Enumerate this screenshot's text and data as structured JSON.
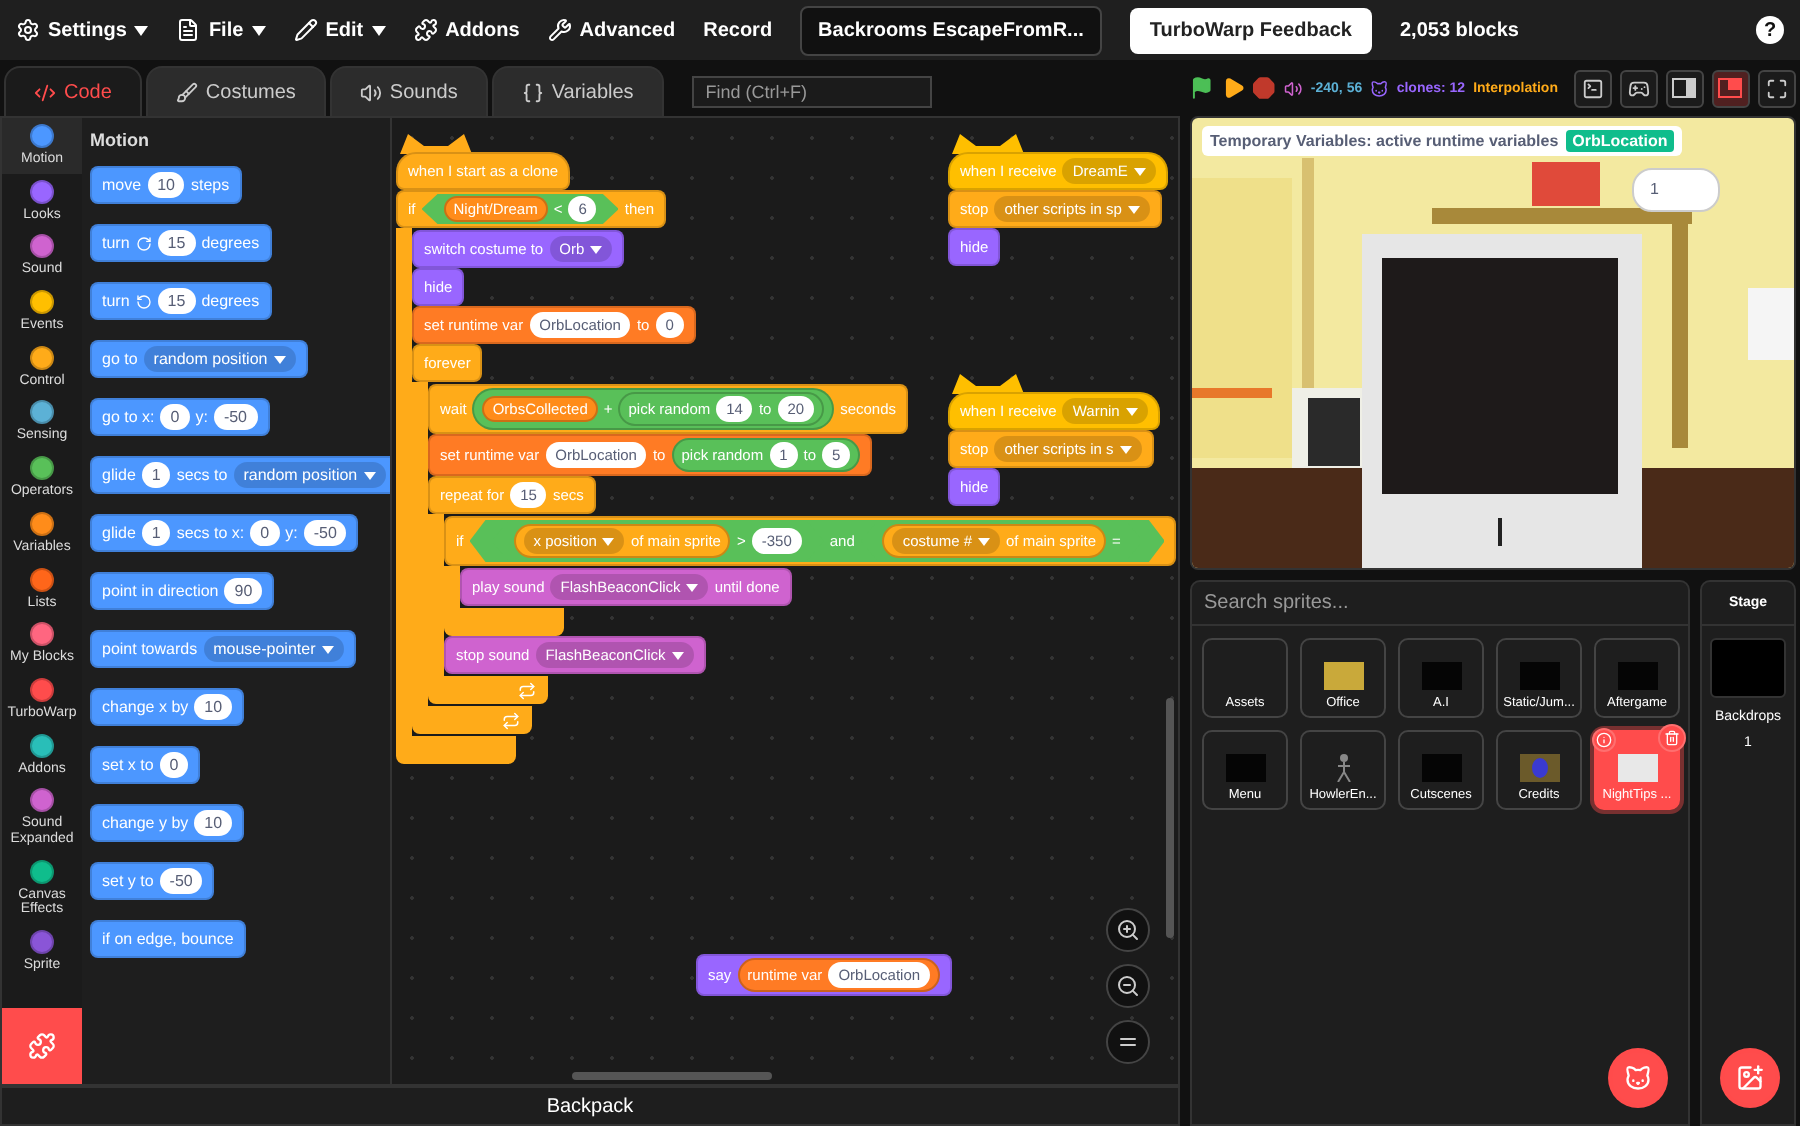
{
  "menubar": {
    "items": [
      {
        "label": "Settings",
        "kind": "settings",
        "menu": true
      },
      {
        "label": "File",
        "kind": "file",
        "menu": true
      },
      {
        "label": "Edit",
        "kind": "edit",
        "menu": true
      },
      {
        "label": "Addons",
        "kind": "addons",
        "menu": false
      },
      {
        "label": "Advanced",
        "kind": "advanced",
        "menu": false
      },
      {
        "label": "Record",
        "kind": "plain",
        "menu": false
      }
    ],
    "project_title": "Backrooms EscapeFromR...",
    "feedback_button": "TurboWarp Feedback",
    "block_count": "2,053 blocks",
    "help": "?"
  },
  "tabs": [
    {
      "label": "Code",
      "kind": "code",
      "selected": true
    },
    {
      "label": "Costumes",
      "kind": "costumes",
      "selected": false
    },
    {
      "label": "Sounds",
      "kind": "sounds",
      "selected": false
    },
    {
      "label": "Variables",
      "kind": "variables",
      "selected": false
    }
  ],
  "find": {
    "placeholder": "Find (Ctrl+F)"
  },
  "stage_controls": {
    "mouse_position": "-240, 56",
    "clones": "clones: 12",
    "interpolation": "Interpolation",
    "buttons": [
      {
        "kind": "terminal",
        "selected": false
      },
      {
        "kind": "gamepad",
        "selected": false
      },
      {
        "kind": "small",
        "selected": false
      },
      {
        "kind": "large",
        "selected": true
      },
      {
        "kind": "fullscreen",
        "selected": false
      }
    ]
  },
  "categories": [
    {
      "label": "Motion",
      "color": "#4c97ff",
      "selected": true
    },
    {
      "label": "Looks",
      "color": "#9966ff",
      "selected": false
    },
    {
      "label": "Sound",
      "color": "#cf63cf",
      "selected": false
    },
    {
      "label": "Events",
      "color": "#ffbf00",
      "selected": false
    },
    {
      "label": "Control",
      "color": "#ffab19",
      "selected": false
    },
    {
      "label": "Sensing",
      "color": "#5cb1d6",
      "selected": false
    },
    {
      "label": "Operators",
      "color": "#59c059",
      "selected": false
    },
    {
      "label": "Variables",
      "color": "#ff8c1a",
      "selected": false
    },
    {
      "label": "Lists",
      "color": "#ff661a",
      "selected": false
    },
    {
      "label": "My Blocks",
      "color": "#ff6680",
      "selected": false
    },
    {
      "label": "TurboWarp",
      "color": "#ff4c4c",
      "selected": false
    },
    {
      "label": "Addons",
      "color": "#29beb8",
      "selected": false
    },
    {
      "label": "Sound Expanded",
      "color": "#cf63cf",
      "selected": false
    },
    {
      "label": "Canvas Effects",
      "color": "#0fbd8c",
      "selected": false
    },
    {
      "label": "Sprite",
      "color": "#8a55d7",
      "selected": false
    }
  ],
  "flyout": {
    "heading": "Motion",
    "blocks": [
      {
        "parts": [
          {
            "kind": "text",
            "text": "move"
          },
          {
            "kind": "number",
            "text": "10"
          },
          {
            "kind": "text",
            "text": "steps"
          }
        ]
      },
      {
        "parts": [
          {
            "kind": "text",
            "text": "turn"
          },
          {
            "kind": "clockwise"
          },
          {
            "kind": "number",
            "text": "15"
          },
          {
            "kind": "text",
            "text": "degrees"
          }
        ]
      },
      {
        "parts": [
          {
            "kind": "text",
            "text": "turn"
          },
          {
            "kind": "counterclockwise"
          },
          {
            "kind": "number",
            "text": "15"
          },
          {
            "kind": "text",
            "text": "degrees"
          }
        ]
      },
      {
        "parts": [
          {
            "kind": "text",
            "text": "go to"
          },
          {
            "kind": "menu",
            "text": "random position"
          }
        ]
      },
      {
        "parts": [
          {
            "kind": "text",
            "text": "go to x:"
          },
          {
            "kind": "number",
            "text": "0"
          },
          {
            "kind": "text",
            "text": "y:"
          },
          {
            "kind": "number",
            "text": "-50"
          }
        ]
      },
      {
        "parts": [
          {
            "kind": "text",
            "text": "glide"
          },
          {
            "kind": "number",
            "text": "1"
          },
          {
            "kind": "text",
            "text": "secs to"
          },
          {
            "kind": "menu",
            "text": "random position"
          }
        ]
      },
      {
        "parts": [
          {
            "kind": "text",
            "text": "glide"
          },
          {
            "kind": "number",
            "text": "1"
          },
          {
            "kind": "text",
            "text": "secs to x:"
          },
          {
            "kind": "number",
            "text": "0"
          },
          {
            "kind": "text",
            "text": "y:"
          },
          {
            "kind": "number",
            "text": "-50"
          }
        ]
      },
      {
        "parts": [
          {
            "kind": "text",
            "text": "point in direction"
          },
          {
            "kind": "number",
            "text": "90"
          }
        ]
      },
      {
        "parts": [
          {
            "kind": "text",
            "text": "point towards"
          },
          {
            "kind": "menu",
            "text": "mouse-pointer"
          }
        ]
      },
      {
        "parts": [
          {
            "kind": "text",
            "text": "change x by"
          },
          {
            "kind": "number",
            "text": "10"
          }
        ]
      },
      {
        "parts": [
          {
            "kind": "text",
            "text": "set x to"
          },
          {
            "kind": "number",
            "text": "0"
          }
        ]
      },
      {
        "parts": [
          {
            "kind": "text",
            "text": "change y by"
          },
          {
            "kind": "number",
            "text": "10"
          }
        ]
      },
      {
        "parts": [
          {
            "kind": "text",
            "text": "set y to"
          },
          {
            "kind": "number",
            "text": "-50"
          }
        ]
      },
      {
        "parts": [
          {
            "kind": "text",
            "text": "if on edge, bounce"
          }
        ]
      }
    ]
  },
  "scripts": [
    {
      "blocks": [
        {
          "kind": "hat",
          "color": "#ffab19",
          "parts": [
            {
              "kind": "text",
              "text": "when I start as a clone"
            }
          ]
        },
        {
          "kind": "c",
          "color": "#ffab19",
          "end_arrow": false,
          "parts": [
            {
              "kind": "text",
              "text": "if"
            },
            {
              "kind": "boolean",
              "color": "#59c059",
              "parts": [
                {
                  "kind": "reporter",
                  "color": "#ff8c1a",
                  "parts": [
                    {
                      "kind": "text",
                      "text": "Night/Dream"
                    }
                  ]
                },
                {
                  "kind": "text",
                  "text": "<"
                },
                {
                  "kind": "number",
                  "text": "6"
                }
              ]
            },
            {
              "kind": "text",
              "text": "then"
            }
          ],
          "children": [
            {
              "kind": "stack",
              "color": "#9966ff",
              "parts": [
                {
                  "kind": "text",
                  "text": "switch costume to"
                },
                {
                  "kind": "menu",
                  "text": "Orb"
                }
              ]
            },
            {
              "kind": "stack",
              "color": "#9966ff",
              "parts": [
                {
                  "kind": "text",
                  "text": "hide"
                }
              ]
            },
            {
              "kind": "stack",
              "color": "#ff7b24",
              "parts": [
                {
                  "kind": "text",
                  "text": "set runtime var"
                },
                {
                  "kind": "number",
                  "text": "OrbLocation"
                },
                {
                  "kind": "text",
                  "text": "to"
                },
                {
                  "kind": "number",
                  "text": "0"
                }
              ]
            },
            {
              "kind": "c",
              "color": "#ffab19",
              "end_arrow": true,
              "parts": [
                {
                  "kind": "text",
                  "text": "forever"
                }
              ],
              "children": [
                {
                  "kind": "stack",
                  "color": "#ffab19",
                  "parts": [
                    {
                      "kind": "text",
                      "text": "wait"
                    },
                    {
                      "kind": "reporter",
                      "color": "#59c059",
                      "parts": [
                        {
                          "kind": "reporter",
                          "color": "#ff8c1a",
                          "parts": [
                            {
                              "kind": "text",
                              "text": "OrbsCollected"
                            }
                          ]
                        },
                        {
                          "kind": "text",
                          "text": "+"
                        },
                        {
                          "kind": "reporter",
                          "color": "#59c059",
                          "parts": [
                            {
                              "kind": "text",
                              "text": "pick random"
                            },
                            {
                              "kind": "number",
                              "text": "14"
                            },
                            {
                              "kind": "text",
                              "text": "to"
                            },
                            {
                              "kind": "number",
                              "text": "20"
                            }
                          ]
                        }
                      ]
                    },
                    {
                      "kind": "text",
                      "text": "seconds"
                    }
                  ]
                },
                {
                  "kind": "stack",
                  "color": "#ff7b24",
                  "parts": [
                    {
                      "kind": "text",
                      "text": "set runtime var"
                    },
                    {
                      "kind": "number",
                      "text": "OrbLocation"
                    },
                    {
                      "kind": "text",
                      "text": "to"
                    },
                    {
                      "kind": "reporter",
                      "color": "#59c059",
                      "parts": [
                        {
                          "kind": "text",
                          "text": "pick random"
                        },
                        {
                          "kind": "number",
                          "text": "1"
                        },
                        {
                          "kind": "text",
                          "text": "to"
                        },
                        {
                          "kind": "number",
                          "text": "5"
                        }
                      ]
                    }
                  ]
                },
                {
                  "kind": "c",
                  "color": "#ffab19",
                  "end_arrow": true,
                  "parts": [
                    {
                      "kind": "text",
                      "text": "repeat for"
                    },
                    {
                      "kind": "number",
                      "text": "15"
                    },
                    {
                      "kind": "text",
                      "text": "secs"
                    }
                  ],
                  "children": [
                    {
                      "kind": "c",
                      "color": "#ffab19",
                      "end_arrow": false,
                      "parts": [
                        {
                          "kind": "text",
                          "text": "if"
                        },
                        {
                          "kind": "boolean",
                          "color": "#59c059",
                          "parts": [
                            {
                              "kind": "boolean",
                              "color": "#59c059",
                              "parts": [
                                {
                                  "kind": "reporter",
                                  "color": "#ffab19",
                                  "parts": [
                                    {
                                      "kind": "menu",
                                      "text": "x position"
                                    },
                                    {
                                      "kind": "text",
                                      "text": "of main sprite"
                                    }
                                  ]
                                },
                                {
                                  "kind": "text",
                                  "text": ">"
                                },
                                {
                                  "kind": "number",
                                  "text": "-350"
                                }
                              ]
                            },
                            {
                              "kind": "text",
                              "text": "and"
                            },
                            {
                              "kind": "boolean",
                              "color": "#59c059",
                              "parts": [
                                {
                                  "kind": "reporter",
                                  "color": "#ffab19",
                                  "parts": [
                                    {
                                      "kind": "menu",
                                      "text": "costume #"
                                    },
                                    {
                                      "kind": "text",
                                      "text": "of main sprite"
                                    }
                                  ]
                                },
                                {
                                  "kind": "text",
                                  "text": "="
                                }
                              ]
                            }
                          ]
                        }
                      ],
                      "children": [
                        {
                          "kind": "stack",
                          "color": "#cf63cf",
                          "parts": [
                            {
                              "kind": "text",
                              "text": "play sound"
                            },
                            {
                              "kind": "menu",
                              "text": "FlashBeaconClick"
                            },
                            {
                              "kind": "text",
                              "text": "until done"
                            }
                          ]
                        }
                      ]
                    },
                    {
                      "kind": "stack",
                      "color": "#cf63cf",
                      "parts": [
                        {
                          "kind": "text",
                          "text": "stop sound"
                        },
                        {
                          "kind": "menu",
                          "text": "FlashBeaconClick"
                        }
                      ]
                    }
                  ]
                }
              ]
            }
          ]
        }
      ]
    },
    {
      "blocks": [
        {
          "kind": "hat",
          "color": "#ffbf00",
          "parts": [
            {
              "kind": "text",
              "text": "when I receive"
            },
            {
              "kind": "menu",
              "text": "DreamE"
            }
          ]
        },
        {
          "kind": "stack",
          "color": "#ffab19",
          "parts": [
            {
              "kind": "text",
              "text": "stop"
            },
            {
              "kind": "menu",
              "text": "other scripts in sp"
            }
          ]
        },
        {
          "kind": "stack",
          "color": "#9966ff",
          "parts": [
            {
              "kind": "text",
              "text": "hide"
            }
          ]
        }
      ]
    },
    {
      "blocks": [
        {
          "kind": "hat",
          "color": "#ffbf00",
          "parts": [
            {
              "kind": "text",
              "text": "when I receive"
            },
            {
              "kind": "menu",
              "text": "Warnin"
            }
          ]
        },
        {
          "kind": "stack",
          "color": "#ffab19",
          "parts": [
            {
              "kind": "text",
              "text": "stop"
            },
            {
              "kind": "menu",
              "text": "other scripts in s"
            }
          ]
        },
        {
          "kind": "stack",
          "color": "#9966ff",
          "parts": [
            {
              "kind": "text",
              "text": "hide"
            }
          ]
        }
      ]
    },
    {
      "blocks": [
        {
          "kind": "stack",
          "color": "#9966ff",
          "parts": [
            {
              "kind": "text",
              "text": "say"
            },
            {
              "kind": "reporter",
              "color": "#ff7b24",
              "parts": [
                {
                  "kind": "text",
                  "text": "runtime var"
                },
                {
                  "kind": "number",
                  "text": "OrbLocation"
                }
              ]
            }
          ]
        }
      ]
    }
  ],
  "stage": {
    "monitor": {
      "label": "Temporary Variables: active runtime variables",
      "value": "OrbLocation"
    },
    "speech": "1"
  },
  "sprites": {
    "placeholder": "Search sprites...",
    "items": [
      {
        "name": "Assets",
        "kind": "blank",
        "selected": false
      },
      {
        "name": "Office",
        "kind": "office",
        "selected": false
      },
      {
        "name": "A.I",
        "kind": "dark",
        "selected": false
      },
      {
        "name": "Static/Jum...",
        "kind": "dark",
        "selected": false
      },
      {
        "name": "Aftergame",
        "kind": "dark",
        "selected": false
      },
      {
        "name": "Menu",
        "kind": "dark",
        "selected": false
      },
      {
        "name": "HowlerEn...",
        "kind": "figure",
        "selected": false
      },
      {
        "name": "Cutscenes",
        "kind": "dark",
        "selected": false
      },
      {
        "name": "Credits",
        "kind": "orb",
        "selected": false
      },
      {
        "name": "NightTips ...",
        "kind": "paper",
        "selected": true
      }
    ]
  },
  "stage_panel": {
    "title": "Stage",
    "backdrops_label": "Backdrops",
    "backdrops_count": "1"
  },
  "backpack": "Backpack"
}
